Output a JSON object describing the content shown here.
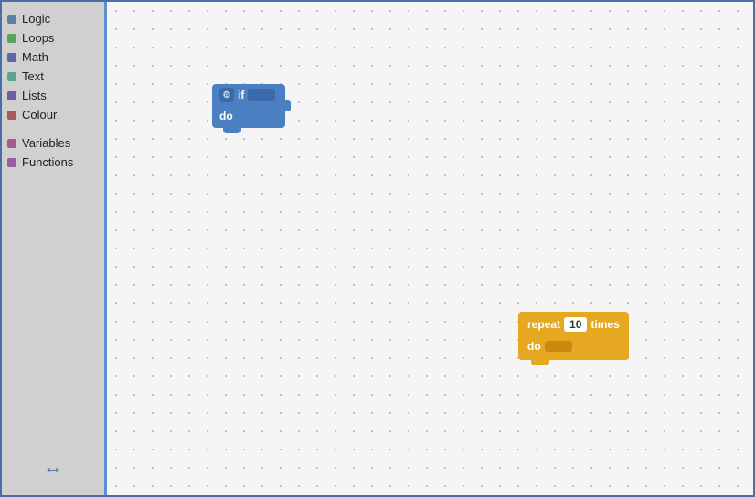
{
  "sidebar": {
    "items": [
      {
        "label": "Logic",
        "color": "#5b80a5",
        "id": "logic"
      },
      {
        "label": "Loops",
        "color": "#5ba55b",
        "id": "loops"
      },
      {
        "label": "Math",
        "color": "#5b67a5",
        "id": "math"
      },
      {
        "label": "Text",
        "color": "#5ba58c",
        "id": "text"
      },
      {
        "label": "Lists",
        "color": "#745ba5",
        "id": "lists"
      },
      {
        "label": "Colour",
        "color": "#a55b5b",
        "id": "colour"
      },
      {
        "label": "Variables",
        "color": "#a55b8c",
        "id": "variables"
      },
      {
        "label": "Functions",
        "color": "#9a5ba5",
        "id": "functions"
      }
    ],
    "resize_label": "↔"
  },
  "if_block": {
    "gear_icon": "⚙",
    "if_label": "if",
    "do_label": "do"
  },
  "repeat_block": {
    "repeat_label": "repeat",
    "number": "10",
    "times_label": "times",
    "do_label": "do"
  }
}
